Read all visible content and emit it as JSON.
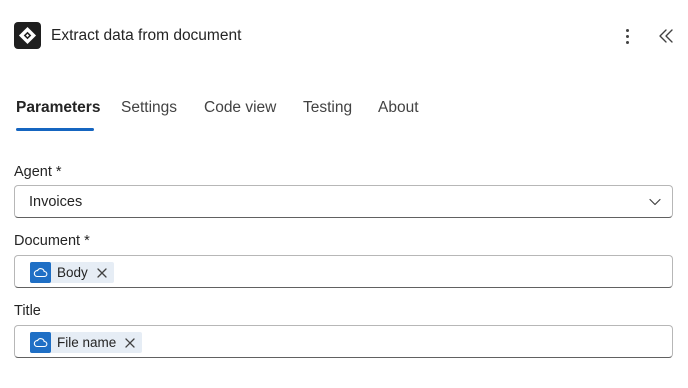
{
  "header": {
    "title": "Extract data from document",
    "app_icon": "ai-builder-diamond-icon",
    "more_icon": "more-vertical-icon",
    "collapse_icon": "double-chevron-left-icon"
  },
  "tabs": [
    {
      "label": "Parameters",
      "active": true
    },
    {
      "label": "Settings",
      "active": false
    },
    {
      "label": "Code view",
      "active": false
    },
    {
      "label": "Testing",
      "active": false
    },
    {
      "label": "About",
      "active": false
    }
  ],
  "fields": {
    "agent": {
      "label": "Agent *",
      "value": "Invoices"
    },
    "document": {
      "label": "Document *",
      "token": "Body",
      "token_icon": "onedrive-cloud-icon"
    },
    "title": {
      "label": "Title",
      "token": "File name",
      "token_icon": "onedrive-cloud-icon"
    }
  },
  "colors": {
    "accent": "#1565c0",
    "token_icon_bg": "#1f6fc5",
    "token_bg": "#e6edf5"
  }
}
